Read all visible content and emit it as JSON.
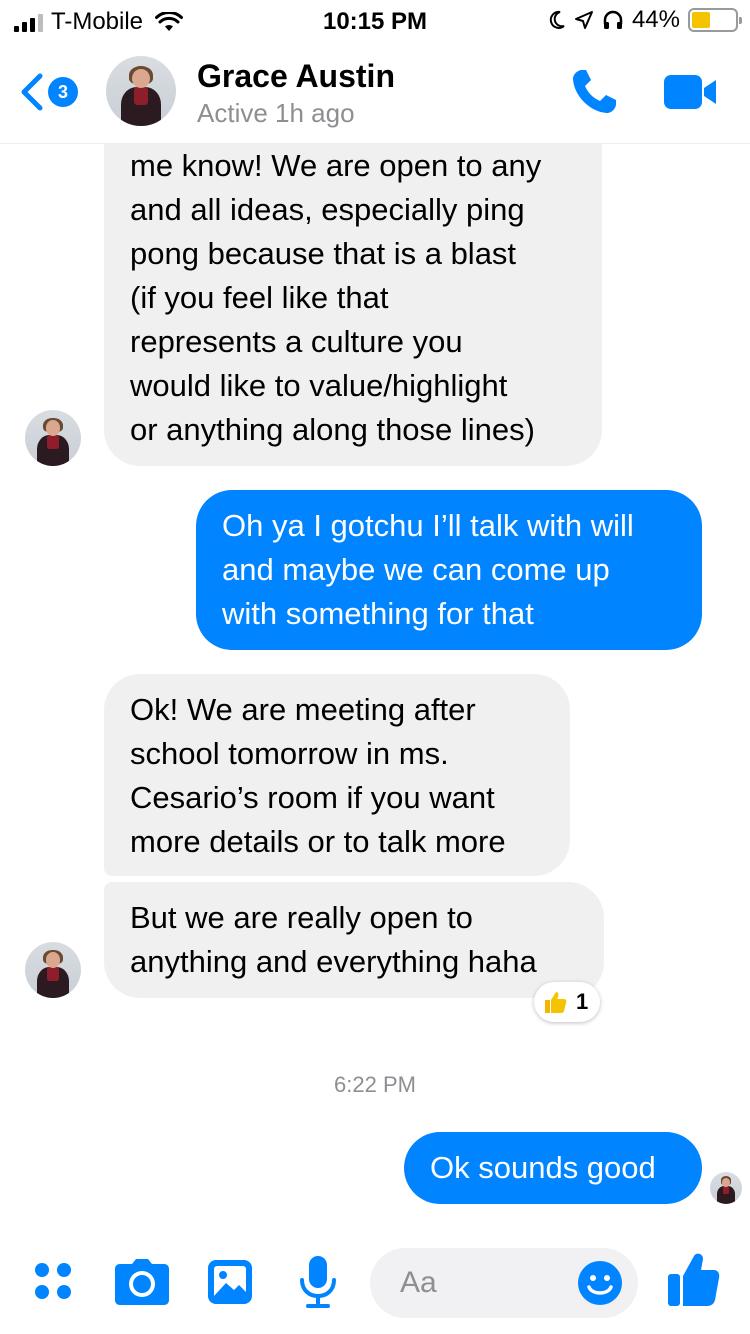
{
  "status_bar": {
    "carrier": "T-Mobile",
    "time": "10:15 PM",
    "battery": "44%",
    "battery_level": 0.44
  },
  "header": {
    "back_badge": "3",
    "contact_name": "Grace Austin",
    "contact_status": "Active 1h ago",
    "icons": [
      "back-icon",
      "phone-icon",
      "video-icon"
    ]
  },
  "messages": [
    {
      "from": "contact",
      "lines": [
        "me know! We are open to any",
        "and all ideas, especially ping",
        "pong because that is a blast",
        "(if you feel like that",
        "represents a culture you",
        "would like to value/highlight",
        "or anything along those lines)"
      ]
    },
    {
      "from": "me",
      "lines": [
        "Oh ya I gotchu I’ll talk with will",
        "and maybe we can come up",
        "with something for that"
      ]
    },
    {
      "from": "contact",
      "lines": [
        "Ok! We are meeting after",
        "school tomorrow in ms.",
        "Cesario’s room if you want",
        "more details or to talk more"
      ]
    },
    {
      "from": "contact",
      "lines": [
        "But we are really open to",
        "anything and everything haha"
      ],
      "reaction": {
        "icon": "thumbs-up-icon",
        "count": "1"
      }
    },
    {
      "from": "me",
      "lines": [
        "Ok sounds good"
      ]
    }
  ],
  "timestamp": "6:22 PM",
  "composer": {
    "placeholder": "Aa",
    "icons": [
      "apps-icon",
      "camera-icon",
      "photo-icon",
      "microphone-icon",
      "emoji-icon",
      "like-icon"
    ]
  },
  "colors": {
    "accent": "#0084ff",
    "incoming_bubble": "#f0f0f0",
    "battery": "#f5c400"
  }
}
